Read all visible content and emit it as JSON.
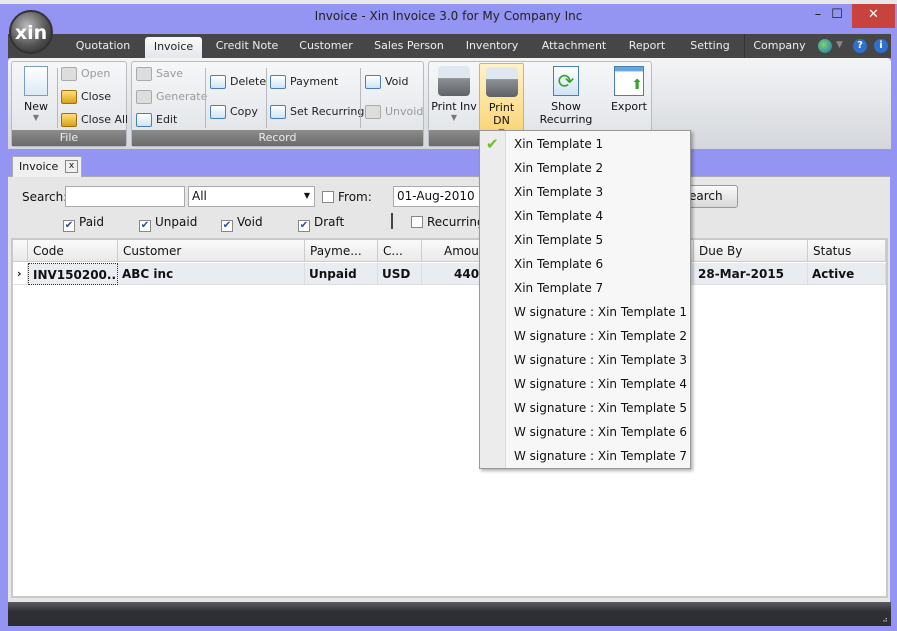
{
  "window": {
    "title": "Invoice - Xin Invoice 3.0 for My Company Inc",
    "logo": "xin",
    "minimize": "–",
    "maximize": "☐",
    "close": "✕"
  },
  "tabs": [
    {
      "label": "Quotation"
    },
    {
      "label": "Invoice",
      "active": true
    },
    {
      "label": "Credit Note"
    },
    {
      "label": "Customer"
    },
    {
      "label": "Sales Person"
    },
    {
      "label": "Inventory"
    },
    {
      "label": "Attachment"
    },
    {
      "label": "Report"
    },
    {
      "label": "Setting"
    },
    {
      "label": "Company"
    }
  ],
  "ribbon": {
    "file": {
      "label": "File",
      "new": "New",
      "open": "Open",
      "close": "Close",
      "close_all": "Close All"
    },
    "record": {
      "label": "Record",
      "save": "Save",
      "generate": "Generate",
      "edit": "Edit",
      "delete": "Delete",
      "copy": "Copy",
      "payment": "Payment",
      "set_recurring": "Set Recurring",
      "void": "Void",
      "unvoid": "Unvoid"
    },
    "print": {
      "print_inv": "Print Inv",
      "print_dn": "Print DN",
      "show_recurring": "Show Recurring",
      "export": "Export"
    }
  },
  "doc_tab": {
    "label": "Invoice",
    "close": "x"
  },
  "filter": {
    "search_label": "Search:",
    "search_value": "",
    "type_value": "All",
    "from_label": "From:",
    "from_checked": false,
    "from_value": "01-Aug-2010",
    "search_button": "Search",
    "checks": [
      {
        "label": "Paid",
        "checked": true
      },
      {
        "label": "Unpaid",
        "checked": true
      },
      {
        "label": "Void",
        "checked": true
      },
      {
        "label": "Draft",
        "checked": true
      },
      {
        "label": "Recurring",
        "checked": false
      }
    ]
  },
  "grid": {
    "columns": [
      "Code",
      "Customer",
      "Payme...",
      "C...",
      "Amour",
      "Due By",
      "Status"
    ],
    "rows": [
      {
        "code": "INV150200...",
        "customer": "ABC inc",
        "payment": "Unpaid",
        "currency": "USD",
        "amount": "440",
        "due_by": "28-Mar-2015",
        "status": "Active"
      }
    ]
  },
  "print_dn_menu": {
    "items": [
      "Xin Template 1",
      "Xin Template 2",
      "Xin Template 3",
      "Xin Template 4",
      "Xin Template 5",
      "Xin Template 6",
      "Xin Template 7",
      "W signature : Xin Template 1",
      "W signature : Xin Template 2",
      "W signature : Xin Template 3",
      "W signature : Xin Template 4",
      "W signature : Xin Template 5",
      "W signature : Xin Template 6",
      "W signature : Xin Template 7"
    ],
    "checked_index": 0
  },
  "colors": {
    "frame": "#9494f2",
    "tabbar": "#464646",
    "close": "#c8423e",
    "highlight": "#fbd67a"
  }
}
